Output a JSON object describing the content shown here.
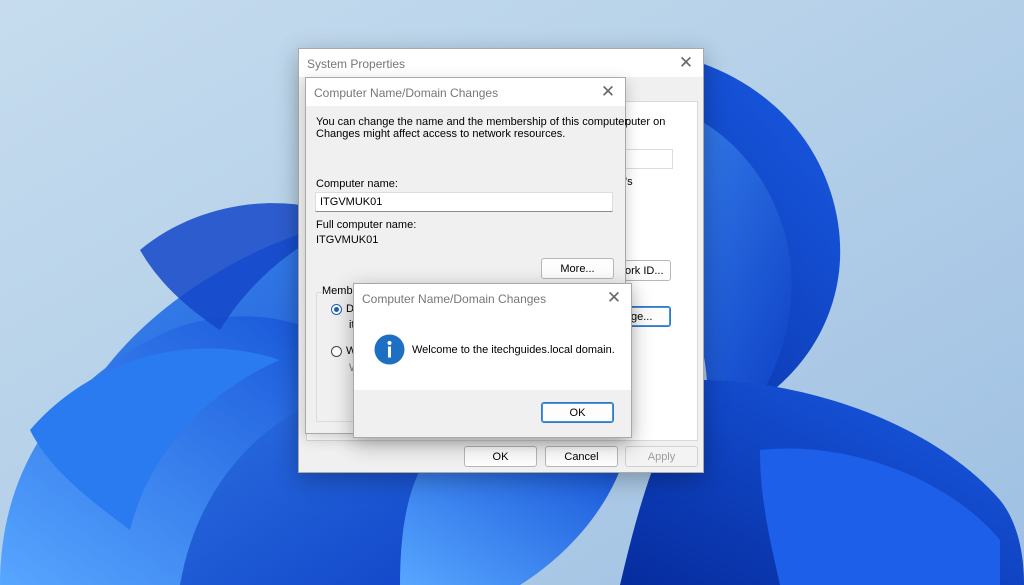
{
  "system_properties": {
    "title": "System Properties",
    "partial_texts": [
      "puter on",
      "'s"
    ],
    "network_id_button": "ork ID...",
    "change_button": "ge...",
    "ok_button": "OK",
    "cancel_button": "Cancel",
    "apply_button": "Apply"
  },
  "name_changes": {
    "title": "Computer Name/Domain Changes",
    "description_line1": "You can change the name and the membership of this computer.",
    "description_line2": "Changes might affect access to network resources.",
    "computer_name_label": "Computer name:",
    "computer_name_value": "ITGVMUK01",
    "full_name_label": "Full computer name:",
    "full_name_value": "ITGVMUK01",
    "more_button": "More...",
    "member_of_partial": "Membe",
    "domain_partial": "D",
    "domain_value_partial": "it",
    "workgroup_partial": "W",
    "workgroup_value_partial": "W"
  },
  "welcome": {
    "title": "Computer Name/Domain Changes",
    "message": "Welcome to the itechguides.local domain.",
    "ok_button": "OK",
    "icon": "info-icon"
  },
  "colors": {
    "accent": "#1f6fcf",
    "info_icon": "#1c6fc1"
  }
}
